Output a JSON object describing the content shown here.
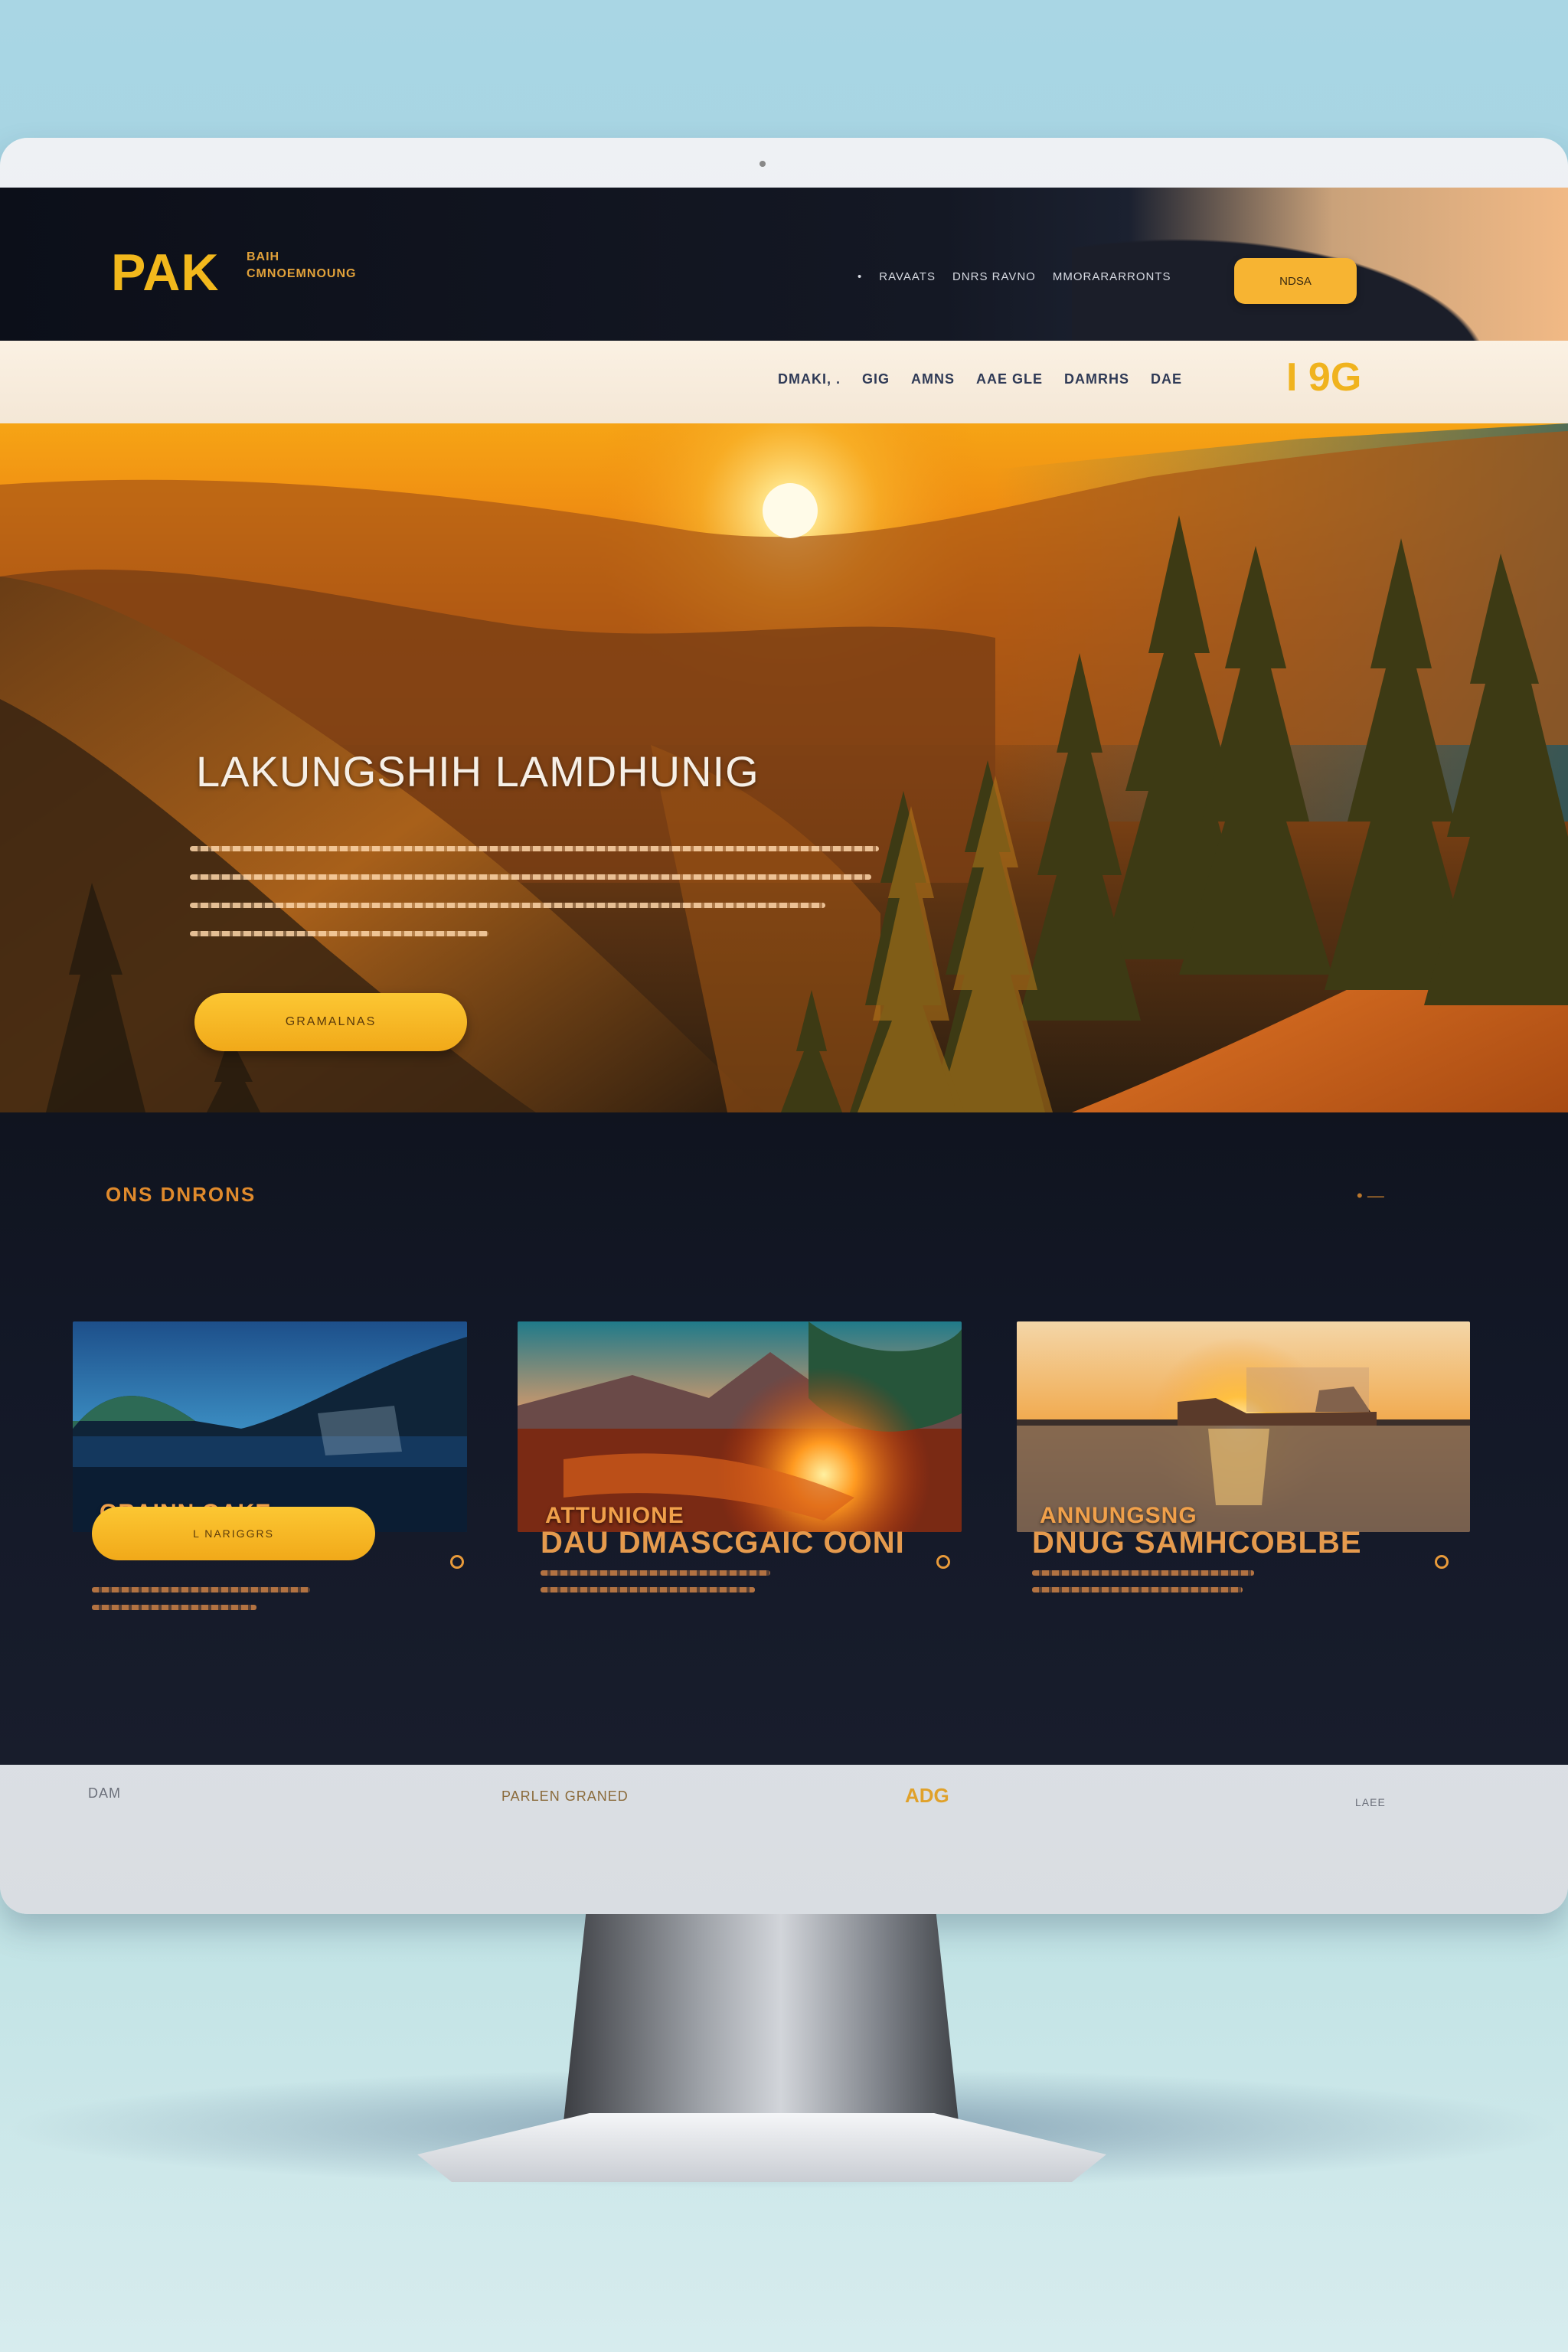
{
  "brand": {
    "logo": "PAK",
    "subtitle": "BAIH CMNOEMNOUNG"
  },
  "top_nav": {
    "items": [
      "•",
      "RAVAATS",
      "DNRS RAVNO",
      "MMORARARRONTS"
    ],
    "cta_label": "NDSA"
  },
  "sub_nav": {
    "items": [
      "DMAKI, .",
      "GIG",
      "AMNS",
      "AAE GLE",
      "DAMRHS",
      "DAE"
    ],
    "badge": "I 9G"
  },
  "hero": {
    "title": "LAKUNGSHIH LAMDHUNIG",
    "button_label": "GRAMALNAS"
  },
  "section": {
    "title": "ONS DNRONS",
    "mark": "• —"
  },
  "cards": [
    {
      "caption": "GRAINN OAKE",
      "button_label": "L NARIGGRS",
      "heading": "",
      "dot_icon": "circle-icon"
    },
    {
      "caption": "ATTUNIONE",
      "button_label": "",
      "heading": "DAU DMASCGAIC OONI",
      "dot_icon": "circle-icon"
    },
    {
      "caption": "ANNUNGSNG",
      "button_label": "",
      "heading": "DNUG SAMHCOBLBE",
      "dot_icon": "circle-icon"
    }
  ],
  "footer": {
    "left": "DAM",
    "center": "PARLEN GRANED",
    "accent": "ADG",
    "right": "LAEE"
  },
  "colors": {
    "accent": "#f2b81c",
    "button": "#f7b432",
    "dark_bg": "#0f1422",
    "caption": "#f0a04a"
  }
}
